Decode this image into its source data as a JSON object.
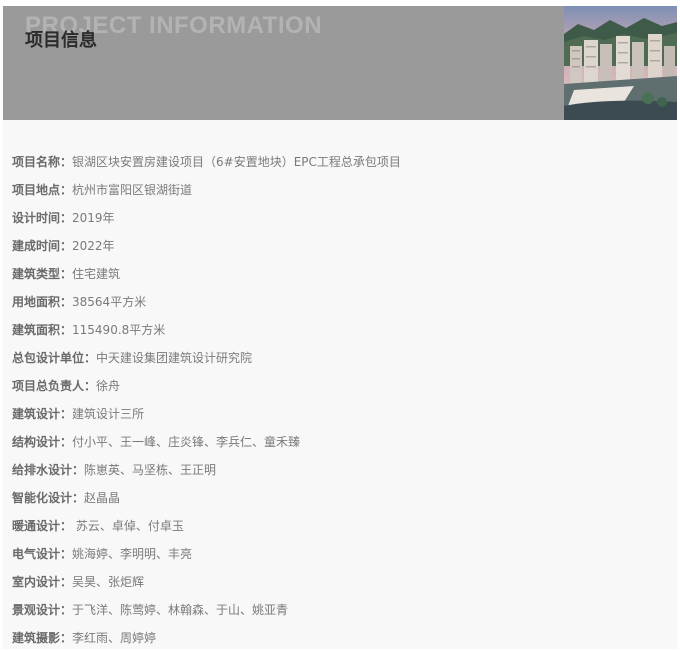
{
  "banner": {
    "title_en": "PROJECT INFORMATION",
    "title_cn": "项目信息",
    "photo": "residential-towers-photo"
  },
  "details": [
    {
      "label": "项目名称：",
      "value": "银湖区块安置房建设项目（6#安置地块）EPC工程总承包项目"
    },
    {
      "label": "项目地点：",
      "value": "杭州市富阳区银湖街道"
    },
    {
      "label": "设计时间：",
      "value": "2019年"
    },
    {
      "label": "建成时间：",
      "value": "2022年"
    },
    {
      "label": "建筑类型：",
      "value": "住宅建筑"
    },
    {
      "label": "用地面积：",
      "value": "38564平方米"
    },
    {
      "label": "建筑面积：",
      "value": "115490.8平方米"
    },
    {
      "label": "总包设计单位：",
      "value": "中天建设集团建筑设计研究院"
    },
    {
      "label": "项目总负责人：",
      "value": "徐舟"
    },
    {
      "label": "建筑设计：",
      "value": "建筑设计三所"
    },
    {
      "label": "结构设计：",
      "value": "付小平、王一峰、庄炎锋、李兵仁、童禾臻"
    },
    {
      "label": "给排水设计：",
      "value": "陈崽英、马坚栋、王正明"
    },
    {
      "label": "智能化设计：",
      "value": "赵晶晶"
    },
    {
      "label": "暖通设计：",
      "value": " 苏云、卓倬、付卓玉"
    },
    {
      "label": "电气设计：",
      "value": "姚海婷、李明明、丰亮"
    },
    {
      "label": "室内设计：",
      "value": "吴昊、张炬辉"
    },
    {
      "label": "景观设计：",
      "value": "于飞洋、陈莺婷、林翰森、于山、姚亚青"
    },
    {
      "label": "建筑摄影：",
      "value": "李红雨、周婷婷"
    }
  ]
}
